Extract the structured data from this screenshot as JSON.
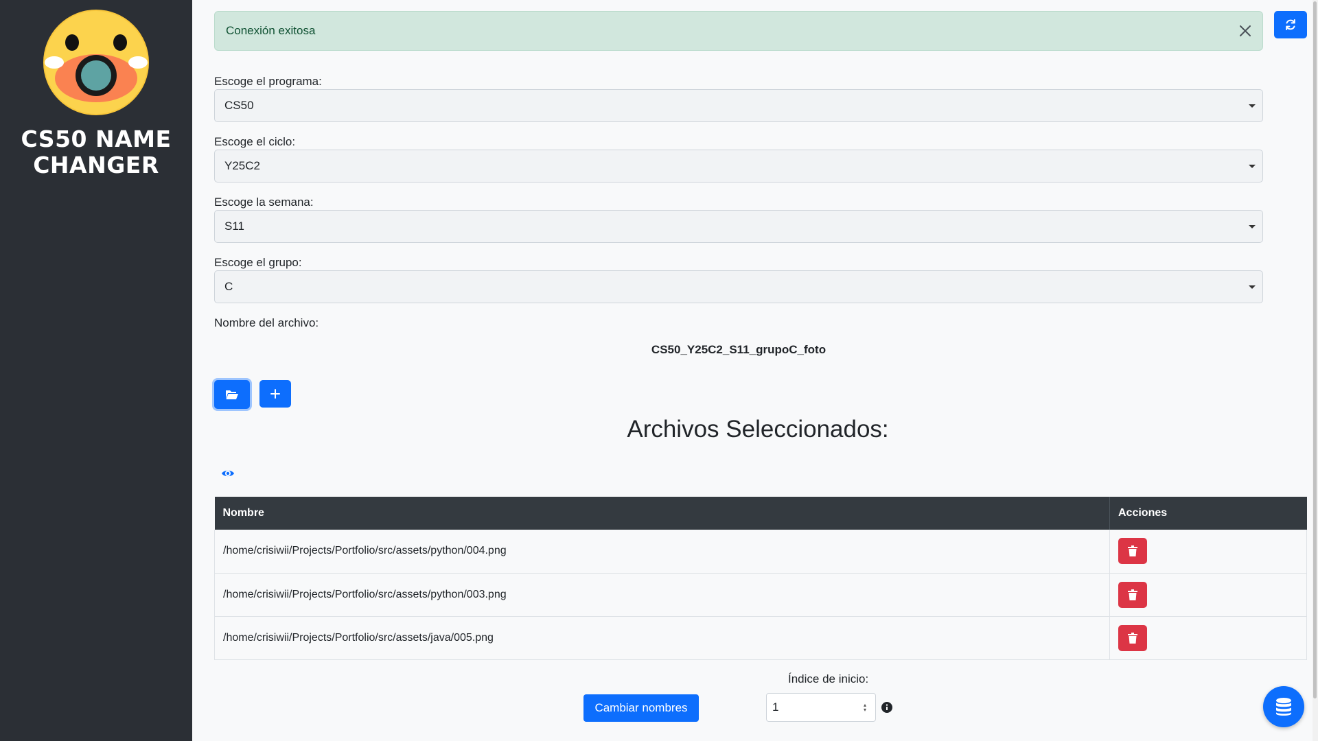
{
  "app": {
    "title": "CS50 NAME CHANGER"
  },
  "alert": {
    "message": "Conexión exitosa"
  },
  "form": {
    "program": {
      "label": "Escoge el programa:",
      "value": "CS50"
    },
    "cycle": {
      "label": "Escoge el ciclo:",
      "value": "Y25C2"
    },
    "week": {
      "label": "Escoge la semana:",
      "value": "S11"
    },
    "group": {
      "label": "Escoge el grupo:",
      "value": "C"
    },
    "filename_label": "Nombre del archivo:",
    "filename_value": "CS50_Y25C2_S11_grupoC_foto"
  },
  "files": {
    "title": "Archivos Seleccionados:",
    "columns": {
      "name": "Nombre",
      "actions": "Acciones"
    },
    "rows": [
      "/home/crisiwii/Projects/Portfolio/src/assets/python/004.png",
      "/home/crisiwii/Projects/Portfolio/src/assets/python/003.png",
      "/home/crisiwii/Projects/Portfolio/src/assets/java/005.png"
    ]
  },
  "rename": {
    "start_label": "Índice de inicio:",
    "start_value": "1",
    "button_label": "Cambiar nombres"
  },
  "colors": {
    "sidebar_bg": "#2b2f35",
    "primary": "#0d6efd",
    "danger": "#dc3545",
    "success_bg": "#d1e7dd",
    "table_header": "#343a40"
  },
  "icons": {
    "logo": "shocked-emoji-icon",
    "close": "close-icon",
    "refresh": "refresh-icon",
    "folder": "folder-open-icon",
    "add": "plus-icon",
    "preview": "eye-icon",
    "delete": "trash-icon",
    "info": "info-icon",
    "database": "database-icon"
  }
}
